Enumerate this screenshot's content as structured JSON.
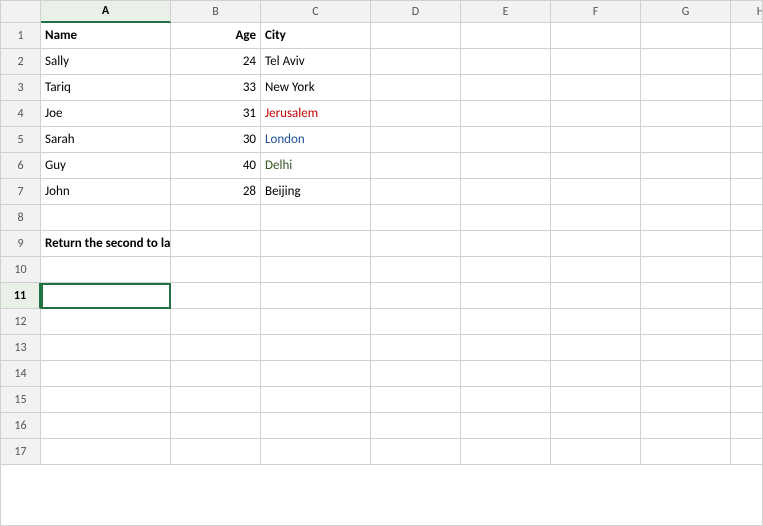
{
  "columns": {
    "headers": [
      "A",
      "B",
      "C",
      "D",
      "E",
      "F",
      "G",
      "H"
    ]
  },
  "rows": [
    {
      "num": 1,
      "cells": [
        {
          "col": "a",
          "value": "Name",
          "bold": true,
          "color": ""
        },
        {
          "col": "b",
          "value": "Age",
          "bold": true,
          "color": ""
        },
        {
          "col": "c",
          "value": "City",
          "bold": true,
          "color": ""
        },
        {
          "col": "d",
          "value": "",
          "bold": false,
          "color": ""
        },
        {
          "col": "e",
          "value": "",
          "bold": false,
          "color": ""
        },
        {
          "col": "f",
          "value": "",
          "bold": false,
          "color": ""
        },
        {
          "col": "g",
          "value": "",
          "bold": false,
          "color": ""
        },
        {
          "col": "h",
          "value": "",
          "bold": false,
          "color": ""
        }
      ]
    },
    {
      "num": 2,
      "cells": [
        {
          "col": "a",
          "value": "Sally",
          "bold": false,
          "color": ""
        },
        {
          "col": "b",
          "value": "24",
          "bold": false,
          "color": ""
        },
        {
          "col": "c",
          "value": "Tel Aviv",
          "bold": false,
          "color": ""
        },
        {
          "col": "d",
          "value": "",
          "bold": false,
          "color": ""
        },
        {
          "col": "e",
          "value": "",
          "bold": false,
          "color": ""
        },
        {
          "col": "f",
          "value": "",
          "bold": false,
          "color": ""
        },
        {
          "col": "g",
          "value": "",
          "bold": false,
          "color": ""
        },
        {
          "col": "h",
          "value": "",
          "bold": false,
          "color": ""
        }
      ]
    },
    {
      "num": 3,
      "cells": [
        {
          "col": "a",
          "value": "Tariq",
          "bold": false,
          "color": ""
        },
        {
          "col": "b",
          "value": "33",
          "bold": false,
          "color": ""
        },
        {
          "col": "c",
          "value": "New York",
          "bold": false,
          "color": ""
        },
        {
          "col": "d",
          "value": "",
          "bold": false,
          "color": ""
        },
        {
          "col": "e",
          "value": "",
          "bold": false,
          "color": ""
        },
        {
          "col": "f",
          "value": "",
          "bold": false,
          "color": ""
        },
        {
          "col": "g",
          "value": "",
          "bold": false,
          "color": ""
        },
        {
          "col": "h",
          "value": "",
          "bold": false,
          "color": ""
        }
      ]
    },
    {
      "num": 4,
      "cells": [
        {
          "col": "a",
          "value": "Joe",
          "bold": false,
          "color": ""
        },
        {
          "col": "b",
          "value": "31",
          "bold": false,
          "color": ""
        },
        {
          "col": "c",
          "value": "Jerusalem",
          "bold": false,
          "color": "red"
        },
        {
          "col": "d",
          "value": "",
          "bold": false,
          "color": ""
        },
        {
          "col": "e",
          "value": "",
          "bold": false,
          "color": ""
        },
        {
          "col": "f",
          "value": "",
          "bold": false,
          "color": ""
        },
        {
          "col": "g",
          "value": "",
          "bold": false,
          "color": ""
        },
        {
          "col": "h",
          "value": "",
          "bold": false,
          "color": ""
        }
      ]
    },
    {
      "num": 5,
      "cells": [
        {
          "col": "a",
          "value": "Sarah",
          "bold": false,
          "color": ""
        },
        {
          "col": "b",
          "value": "30",
          "bold": false,
          "color": ""
        },
        {
          "col": "c",
          "value": "London",
          "bold": false,
          "color": "blue"
        },
        {
          "col": "d",
          "value": "",
          "bold": false,
          "color": ""
        },
        {
          "col": "e",
          "value": "",
          "bold": false,
          "color": ""
        },
        {
          "col": "f",
          "value": "",
          "bold": false,
          "color": ""
        },
        {
          "col": "g",
          "value": "",
          "bold": false,
          "color": ""
        },
        {
          "col": "h",
          "value": "",
          "bold": false,
          "color": ""
        }
      ]
    },
    {
      "num": 6,
      "cells": [
        {
          "col": "a",
          "value": "Guy",
          "bold": false,
          "color": ""
        },
        {
          "col": "b",
          "value": "40",
          "bold": false,
          "color": ""
        },
        {
          "col": "c",
          "value": "Delhi",
          "bold": false,
          "color": "green"
        },
        {
          "col": "d",
          "value": "",
          "bold": false,
          "color": ""
        },
        {
          "col": "e",
          "value": "",
          "bold": false,
          "color": ""
        },
        {
          "col": "f",
          "value": "",
          "bold": false,
          "color": ""
        },
        {
          "col": "g",
          "value": "",
          "bold": false,
          "color": ""
        },
        {
          "col": "h",
          "value": "",
          "bold": false,
          "color": ""
        }
      ]
    },
    {
      "num": 7,
      "cells": [
        {
          "col": "a",
          "value": "John",
          "bold": false,
          "color": ""
        },
        {
          "col": "b",
          "value": "28",
          "bold": false,
          "color": ""
        },
        {
          "col": "c",
          "value": "Beijing",
          "bold": false,
          "color": ""
        },
        {
          "col": "d",
          "value": "",
          "bold": false,
          "color": ""
        },
        {
          "col": "e",
          "value": "",
          "bold": false,
          "color": ""
        },
        {
          "col": "f",
          "value": "",
          "bold": false,
          "color": ""
        },
        {
          "col": "g",
          "value": "",
          "bold": false,
          "color": ""
        },
        {
          "col": "h",
          "value": "",
          "bold": false,
          "color": ""
        }
      ]
    },
    {
      "num": 8,
      "cells": [
        {
          "col": "a",
          "value": "",
          "bold": false
        },
        {
          "col": "b",
          "value": "",
          "bold": false
        },
        {
          "col": "c",
          "value": "",
          "bold": false
        },
        {
          "col": "d",
          "value": "",
          "bold": false
        },
        {
          "col": "e",
          "value": "",
          "bold": false
        },
        {
          "col": "f",
          "value": "",
          "bold": false
        },
        {
          "col": "g",
          "value": "",
          "bold": false
        },
        {
          "col": "h",
          "value": "",
          "bold": false
        }
      ]
    },
    {
      "num": 9,
      "cells": [
        {
          "col": "a",
          "value": "Return the second to last row:",
          "bold": true,
          "color": "",
          "span": true
        },
        {
          "col": "b",
          "value": "",
          "bold": false
        },
        {
          "col": "c",
          "value": "",
          "bold": false
        },
        {
          "col": "d",
          "value": "",
          "bold": false
        },
        {
          "col": "e",
          "value": "",
          "bold": false
        },
        {
          "col": "f",
          "value": "",
          "bold": false
        },
        {
          "col": "g",
          "value": "",
          "bold": false
        },
        {
          "col": "h",
          "value": "",
          "bold": false
        }
      ]
    },
    {
      "num": 10,
      "cells": [
        {
          "col": "a",
          "value": "",
          "bold": false
        },
        {
          "col": "b",
          "value": "",
          "bold": false
        },
        {
          "col": "c",
          "value": "",
          "bold": false
        },
        {
          "col": "d",
          "value": "",
          "bold": false
        },
        {
          "col": "e",
          "value": "",
          "bold": false
        },
        {
          "col": "f",
          "value": "",
          "bold": false
        },
        {
          "col": "g",
          "value": "",
          "bold": false
        },
        {
          "col": "h",
          "value": "",
          "bold": false
        }
      ]
    },
    {
      "num": 11,
      "cells": [
        {
          "col": "a",
          "value": "",
          "bold": false,
          "active": true
        },
        {
          "col": "b",
          "value": "",
          "bold": false
        },
        {
          "col": "c",
          "value": "",
          "bold": false
        },
        {
          "col": "d",
          "value": "",
          "bold": false
        },
        {
          "col": "e",
          "value": "",
          "bold": false
        },
        {
          "col": "f",
          "value": "",
          "bold": false
        },
        {
          "col": "g",
          "value": "",
          "bold": false
        },
        {
          "col": "h",
          "value": "",
          "bold": false
        }
      ]
    },
    {
      "num": 12,
      "cells": [
        {
          "col": "a",
          "value": "",
          "bold": false
        },
        {
          "col": "b",
          "value": "",
          "bold": false
        },
        {
          "col": "c",
          "value": "",
          "bold": false
        },
        {
          "col": "d",
          "value": "",
          "bold": false
        },
        {
          "col": "e",
          "value": "",
          "bold": false
        },
        {
          "col": "f",
          "value": "",
          "bold": false
        },
        {
          "col": "g",
          "value": "",
          "bold": false
        },
        {
          "col": "h",
          "value": "",
          "bold": false
        }
      ]
    },
    {
      "num": 13,
      "cells": [
        {
          "col": "a",
          "value": "",
          "bold": false
        },
        {
          "col": "b",
          "value": "",
          "bold": false
        },
        {
          "col": "c",
          "value": "",
          "bold": false
        },
        {
          "col": "d",
          "value": "",
          "bold": false
        },
        {
          "col": "e",
          "value": "",
          "bold": false
        },
        {
          "col": "f",
          "value": "",
          "bold": false
        },
        {
          "col": "g",
          "value": "",
          "bold": false
        },
        {
          "col": "h",
          "value": "",
          "bold": false
        }
      ]
    },
    {
      "num": 14,
      "cells": [
        {
          "col": "a",
          "value": "",
          "bold": false
        },
        {
          "col": "b",
          "value": "",
          "bold": false
        },
        {
          "col": "c",
          "value": "",
          "bold": false
        },
        {
          "col": "d",
          "value": "",
          "bold": false
        },
        {
          "col": "e",
          "value": "",
          "bold": false
        },
        {
          "col": "f",
          "value": "",
          "bold": false
        },
        {
          "col": "g",
          "value": "",
          "bold": false
        },
        {
          "col": "h",
          "value": "",
          "bold": false
        }
      ]
    },
    {
      "num": 15,
      "cells": [
        {
          "col": "a",
          "value": "",
          "bold": false
        },
        {
          "col": "b",
          "value": "",
          "bold": false
        },
        {
          "col": "c",
          "value": "",
          "bold": false
        },
        {
          "col": "d",
          "value": "",
          "bold": false
        },
        {
          "col": "e",
          "value": "",
          "bold": false
        },
        {
          "col": "f",
          "value": "",
          "bold": false
        },
        {
          "col": "g",
          "value": "",
          "bold": false
        },
        {
          "col": "h",
          "value": "",
          "bold": false
        }
      ]
    },
    {
      "num": 16,
      "cells": [
        {
          "col": "a",
          "value": "",
          "bold": false
        },
        {
          "col": "b",
          "value": "",
          "bold": false
        },
        {
          "col": "c",
          "value": "",
          "bold": false
        },
        {
          "col": "d",
          "value": "",
          "bold": false
        },
        {
          "col": "e",
          "value": "",
          "bold": false
        },
        {
          "col": "f",
          "value": "",
          "bold": false
        },
        {
          "col": "g",
          "value": "",
          "bold": false
        },
        {
          "col": "h",
          "value": "",
          "bold": false
        }
      ]
    },
    {
      "num": 17,
      "cells": [
        {
          "col": "a",
          "value": "",
          "bold": false
        },
        {
          "col": "b",
          "value": "",
          "bold": false
        },
        {
          "col": "c",
          "value": "",
          "bold": false
        },
        {
          "col": "d",
          "value": "",
          "bold": false
        },
        {
          "col": "e",
          "value": "",
          "bold": false
        },
        {
          "col": "f",
          "value": "",
          "bold": false
        },
        {
          "col": "g",
          "value": "",
          "bold": false
        },
        {
          "col": "h",
          "value": "",
          "bold": false
        }
      ]
    }
  ],
  "active_cell": "A11",
  "active_row": 11,
  "active_col": "A"
}
